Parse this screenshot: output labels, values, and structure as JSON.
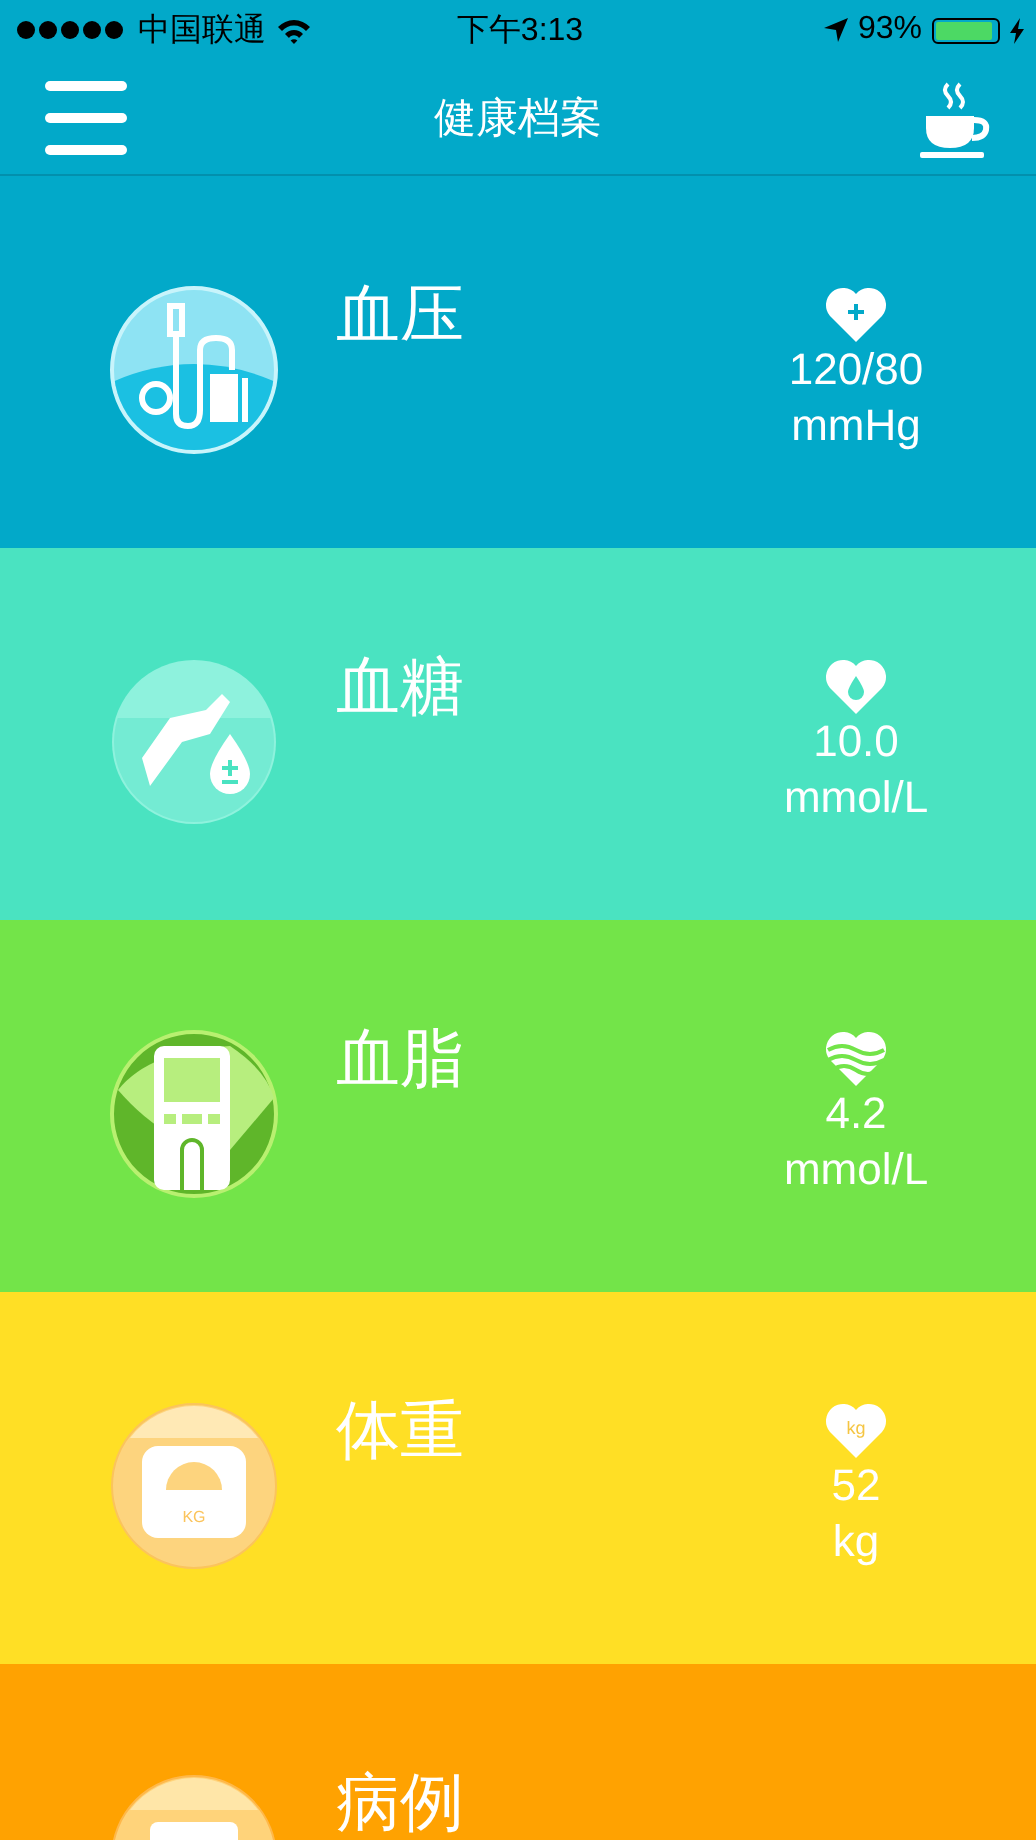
{
  "status_bar": {
    "carrier": "中国联通",
    "time": "下午3:13",
    "battery_percent": "93%",
    "battery": {
      "level": 0.93,
      "charging": true
    }
  },
  "header": {
    "title": "健康档案"
  },
  "rows": [
    {
      "kind": "pressure",
      "name": "血压",
      "color": "#02a9c9",
      "value": "120/80",
      "unit": "mmHg"
    },
    {
      "kind": "glucose",
      "name": "血糖",
      "color": "#4ae3c1",
      "value": "10.0",
      "unit": "mmol/L"
    },
    {
      "kind": "lipid",
      "name": "血脂",
      "color": "#73e449",
      "value": "4.2",
      "unit": "mmol/L"
    },
    {
      "kind": "weight",
      "name": "体重",
      "color": "#ffdf25",
      "value": "52",
      "unit": "kg",
      "heart_label": "kg",
      "icon_label": "KG"
    },
    {
      "kind": "record",
      "name": "病例",
      "color": "#ffa201"
    }
  ]
}
